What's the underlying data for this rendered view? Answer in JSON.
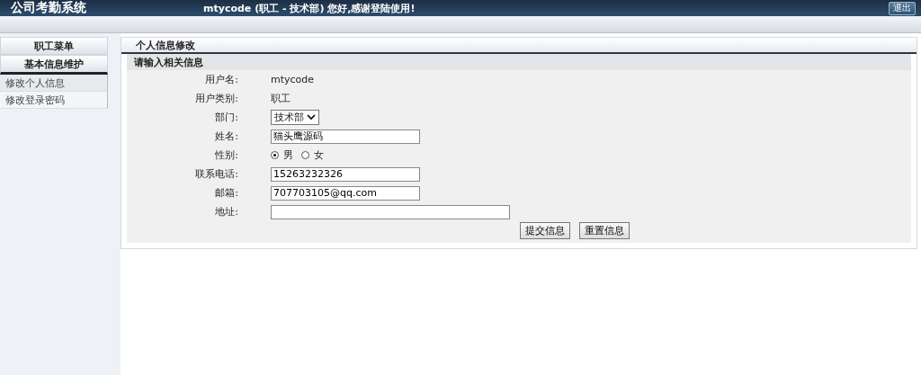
{
  "header": {
    "title": "公司考勤系统",
    "greeting": "mtycode (职工 - 技术部) 您好,感谢登陆使用!",
    "logout": "退出"
  },
  "sidebar": {
    "title": "职工菜单",
    "section": "基本信息维护",
    "items": [
      {
        "label": "修改个人信息",
        "selected": true
      },
      {
        "label": "修改登录密码",
        "selected": false
      }
    ]
  },
  "panel": {
    "title": "个人信息修改",
    "subtitle": "请输入相关信息"
  },
  "fields": [
    {
      "kind": "text",
      "label": "用户名:",
      "value": "mtycode"
    },
    {
      "kind": "text",
      "label": "用户类别:",
      "value": "职工"
    },
    {
      "kind": "select",
      "label": "部门:",
      "value": "技术部"
    },
    {
      "kind": "input",
      "label": "姓名:",
      "value": "猫头鹰源码",
      "wide": false
    },
    {
      "kind": "radio",
      "label": "性别:",
      "options": [
        {
          "label": "男",
          "selected": true
        },
        {
          "label": "女",
          "selected": false
        }
      ]
    },
    {
      "kind": "input",
      "label": "联系电话:",
      "value": "15263232326",
      "wide": false
    },
    {
      "kind": "input",
      "label": "邮箱:",
      "value": "707703105@qq.com",
      "wide": false
    },
    {
      "kind": "input",
      "label": "地址:",
      "wide": true
    }
  ],
  "buttons": [
    "提交信息",
    "重置信息"
  ]
}
